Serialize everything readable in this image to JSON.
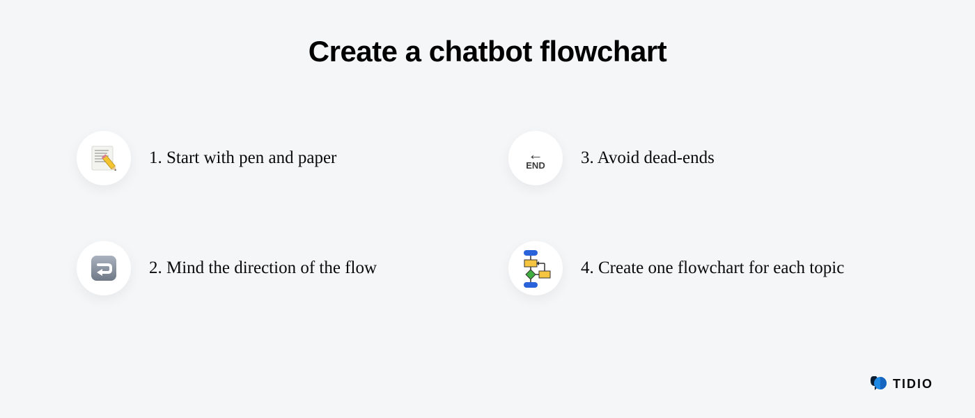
{
  "title": "Create a chatbot flowchart",
  "items": [
    {
      "number": "1.",
      "label": "Start with pen and paper",
      "icon": "memo-pencil-icon"
    },
    {
      "number": "2.",
      "label": "Mind the direction of the flow",
      "icon": "return-arrow-icon"
    },
    {
      "number": "3.",
      "label": "Avoid dead-ends",
      "icon": "end-arrow-icon"
    },
    {
      "number": "4.",
      "label": "Create one flowchart for each topic",
      "icon": "flowchart-icon"
    }
  ],
  "brand": {
    "name": "TIDIO"
  }
}
